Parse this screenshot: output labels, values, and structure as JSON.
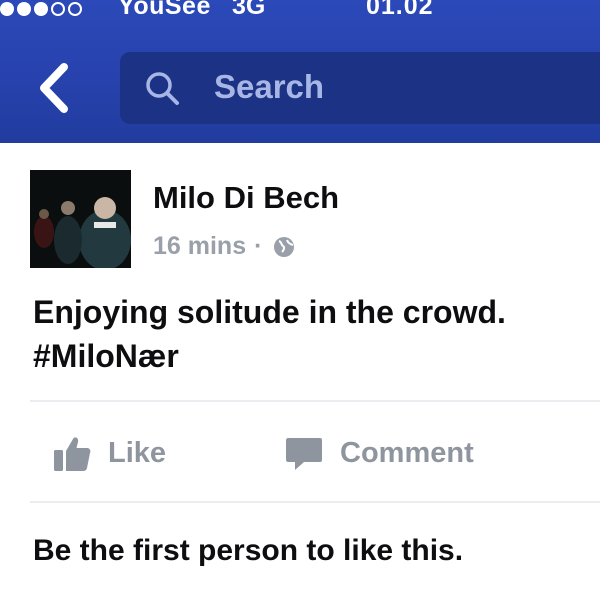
{
  "status_bar": {
    "signal_dots_filled": 3,
    "signal_dots_total": 5,
    "carrier": "YouSee",
    "network": "3G",
    "time": "01.02"
  },
  "nav": {
    "back_icon": "chevron-left-icon",
    "search_placeholder": "Search"
  },
  "post": {
    "author": "Milo Di Bech",
    "time_ago": "16 mins",
    "separator": "·",
    "privacy_icon": "globe-icon",
    "text_line1": "Enjoying solitude in the crowd.",
    "text_line2": "#MiloNær"
  },
  "actions": {
    "like_label": "Like",
    "comment_label": "Comment"
  },
  "likes_summary": "Be the first person to like this.",
  "colors": {
    "header_blue": "#2742ad",
    "search_field": "#1b3285",
    "action_gray": "#8f959f",
    "meta_gray": "#9aa0aa"
  }
}
